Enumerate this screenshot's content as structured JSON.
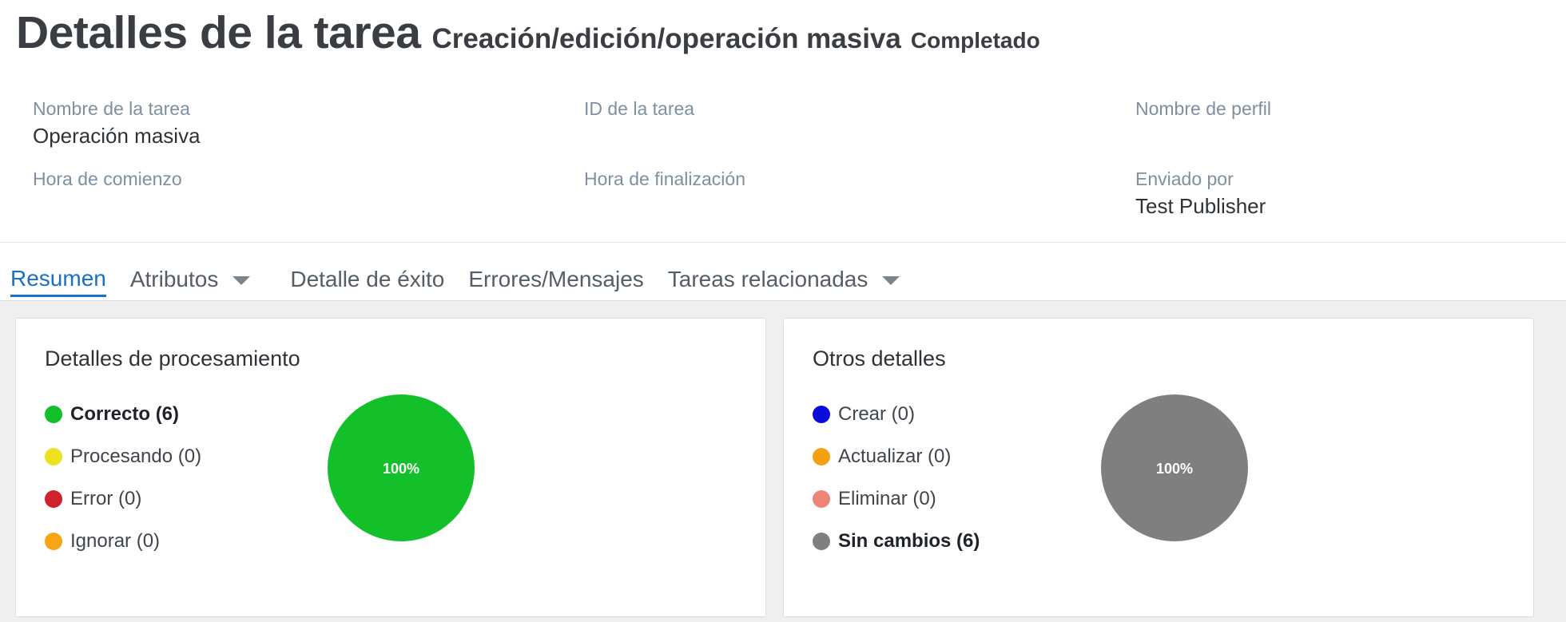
{
  "header": {
    "title": "Detalles de la tarea",
    "subtitle": "Creación/edición/operación masiva",
    "status": "Completado"
  },
  "info": {
    "task_name": {
      "label": "Nombre de la tarea",
      "value": "Operación masiva"
    },
    "task_id": {
      "label": "ID de la tarea",
      "value": ""
    },
    "profile_name": {
      "label": "Nombre de perfil",
      "value": ""
    },
    "start_time": {
      "label": "Hora de comienzo",
      "value": ""
    },
    "end_time": {
      "label": "Hora de finalización",
      "value": ""
    },
    "sent_by": {
      "label": "Enviado por",
      "value": "Test Publisher"
    }
  },
  "tabs": [
    {
      "label": "Resumen",
      "active": true
    },
    {
      "label": "Atributos",
      "dropdown": true
    },
    {
      "label": "Detalle de éxito"
    },
    {
      "label": "Errores/Mensajes"
    },
    {
      "label": "Tareas relacionadas",
      "dropdown": true
    }
  ],
  "processing": {
    "title": "Detalles de procesamiento",
    "legend": [
      {
        "label": "Correcto (6)",
        "color": "#14c02a",
        "bold": true
      },
      {
        "label": "Procesando (0)",
        "color": "#ede21f"
      },
      {
        "label": "Error (0)",
        "color": "#d0222b"
      },
      {
        "label": "Ignorar (0)",
        "color": "#f7a515"
      }
    ],
    "pie_label": "100%"
  },
  "other": {
    "title": "Otros detalles",
    "legend": [
      {
        "label": "Crear (0)",
        "color": "#0a0adc"
      },
      {
        "label": "Actualizar (0)",
        "color": "#f5a013"
      },
      {
        "label": "Eliminar (0)",
        "color": "#f08479"
      },
      {
        "label": "Sin cambios (6)",
        "color": "#7f7f7f",
        "bold": true
      }
    ],
    "pie_label": "100%"
  },
  "chart_data": [
    {
      "type": "pie",
      "categories": [
        "Correcto",
        "Procesando",
        "Error",
        "Ignorar"
      ],
      "values": [
        6,
        0,
        0,
        0
      ],
      "colors": [
        "#14c02a",
        "#ede21f",
        "#d0222b",
        "#f7a515"
      ]
    },
    {
      "type": "pie",
      "categories": [
        "Crear",
        "Actualizar",
        "Eliminar",
        "Sin cambios"
      ],
      "values": [
        0,
        0,
        0,
        6
      ],
      "colors": [
        "#0a0adc",
        "#f5a013",
        "#f08479",
        "#7f7f7f"
      ]
    }
  ]
}
